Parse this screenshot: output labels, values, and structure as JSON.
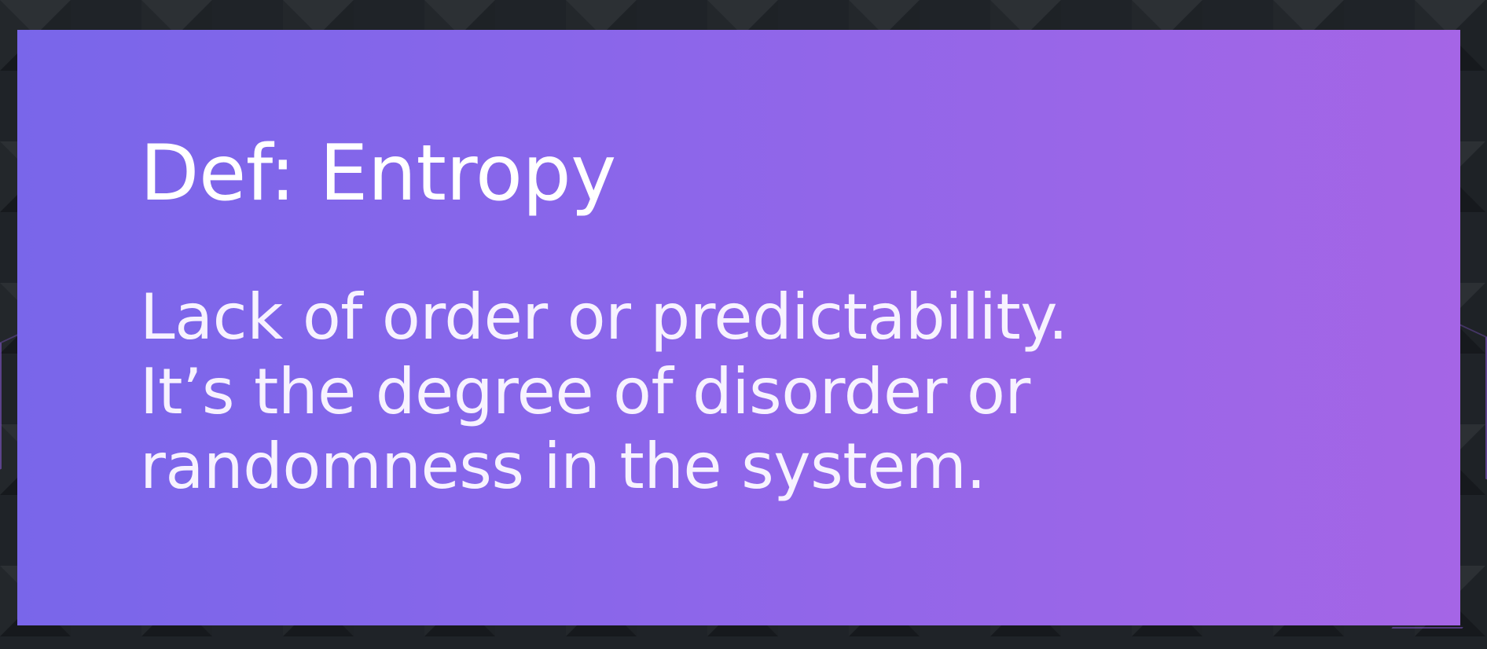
{
  "slide": {
    "title": "Def: Entropy",
    "definition_lines": [
      "Lack of order or predictability.",
      "It’s the degree of disorder or",
      "randomness in the system."
    ]
  },
  "colors": {
    "background": "#1f2328",
    "card_gradient_start": "#7966ea",
    "card_gradient_end": "#a565e6",
    "text": "#ffffff",
    "accent_line": "#8c5adc"
  }
}
